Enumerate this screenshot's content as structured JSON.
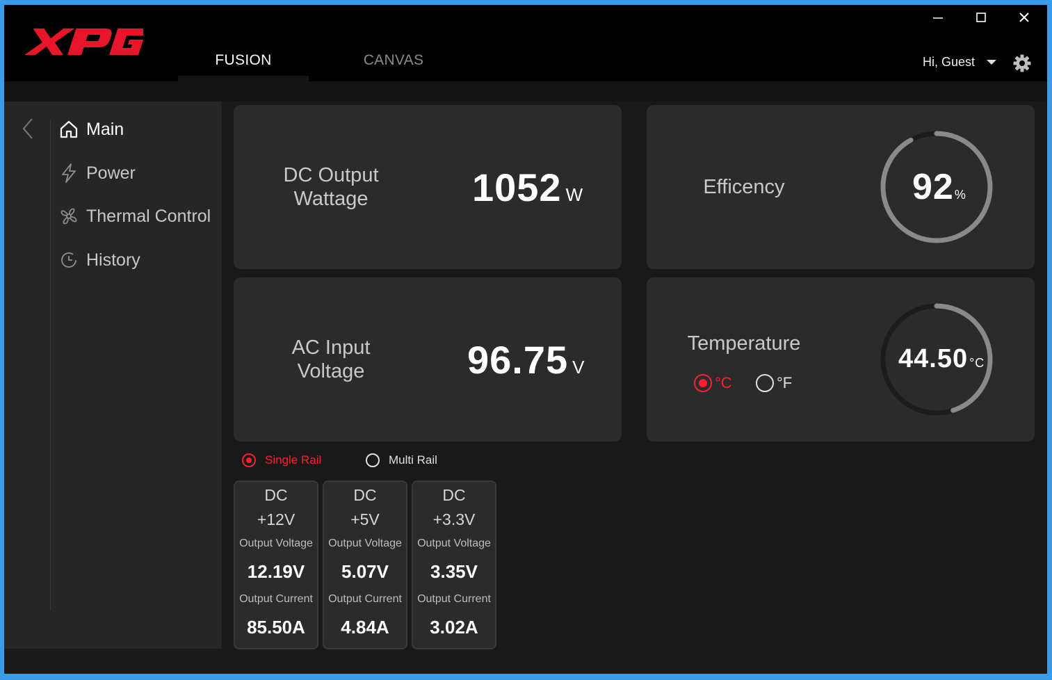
{
  "app": {
    "logo_text": "XPG"
  },
  "tabs": [
    {
      "label": "FUSION",
      "active": true
    },
    {
      "label": "CANVAS",
      "active": false
    }
  ],
  "window_controls": {
    "minimize": "—",
    "maximize": "☐",
    "close": "✕"
  },
  "user": {
    "greeting": "Hi, Guest"
  },
  "sidebar": {
    "items": [
      {
        "label": "Main",
        "icon": "home-icon",
        "active": true
      },
      {
        "label": "Power",
        "icon": "bolt-icon",
        "active": false
      },
      {
        "label": "Thermal Control",
        "icon": "fan-icon",
        "active": false
      },
      {
        "label": "History",
        "icon": "clock-icon",
        "active": false
      }
    ]
  },
  "dc_output": {
    "label_line1": "DC Output",
    "label_line2": "Wattage",
    "value": "1052",
    "unit": "W"
  },
  "efficiency": {
    "label": "Efficency",
    "value": "92",
    "unit": "%",
    "percent": 92
  },
  "ac_input": {
    "label_line1": "AC Input",
    "label_line2": "Voltage",
    "value": "96.75",
    "unit": "V"
  },
  "temperature": {
    "label": "Temperature",
    "value": "44.50",
    "unit": "°C",
    "celsius_label": "°C",
    "fahrenheit_label": "°F",
    "selected": "celsius",
    "gauge_fraction": 0.45
  },
  "rail_mode": {
    "single_label": "Single Rail",
    "multi_label": "Multi Rail",
    "selected": "single"
  },
  "rails": [
    {
      "line1": "DC",
      "line2": "+12V",
      "voltage_label": "Output Voltage",
      "voltage": "12.19V",
      "current_label": "Output Current",
      "current": "85.50A"
    },
    {
      "line1": "DC",
      "line2": "+5V",
      "voltage_label": "Output Voltage",
      "voltage": "5.07V",
      "current_label": "Output Current",
      "current": "4.84A"
    },
    {
      "line1": "DC",
      "line2": "+3.3V",
      "voltage_label": "Output Voltage",
      "voltage": "3.35V",
      "current_label": "Output Current",
      "current": "3.02A"
    }
  ],
  "colors": {
    "accent": "#ff1f2d",
    "gauge": "#8a8a8a",
    "gauge_track": "#1c1c1c",
    "card": "#2b2b2b",
    "background": "#191919",
    "frame": "#3a9be8"
  }
}
